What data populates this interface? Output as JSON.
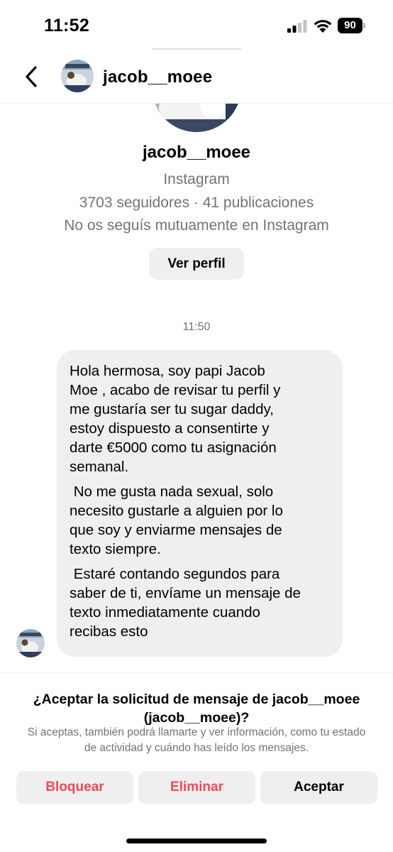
{
  "status_bar": {
    "time": "11:52",
    "battery": "90"
  },
  "header": {
    "username": "jacob__moee"
  },
  "profile": {
    "name": "jacob__moee",
    "source": "Instagram",
    "stats": "3703 seguidores · 41 publicaciones",
    "mutual": "No os seguís mutuamente en Instagram",
    "view_profile_label": "Ver perfil"
  },
  "conversation": {
    "timestamp": "11:50",
    "message_paragraphs": [
      "Hola hermosa, soy papi Jacob\nMoe , acabo de revisar tu perfil y\nme gustaría ser tu sugar daddy,\nestoy dispuesto a consentirte y\ndarte €5000 como tu asignación\nsemanal.",
      " No me gusta nada sexual, solo\nnecesito gustarle a alguien por lo\nque soy y enviarme mensajes de\ntexto siempre.",
      " Estaré contando segundos para\nsaber de ti, envíame un mensaje de\ntexto inmediatamente cuando\nrecibas esto"
    ]
  },
  "request": {
    "title": "¿Aceptar la solicitud de mensaje de jacob__moee (jacob__moee)?",
    "description": "Si aceptas, también podrá llamarte y ver información, como tu estado de actividad y cuándo has leído los mensajes.",
    "block_label": "Bloquear",
    "delete_label": "Eliminar",
    "accept_label": "Aceptar"
  },
  "icons": {
    "back": "chevron-left-icon",
    "signal": "cellular-signal-icon",
    "wifi": "wifi-icon",
    "battery": "battery-icon"
  },
  "colors": {
    "destructive": "#ed4956",
    "secondary_text": "#737373",
    "button_bg": "#efefef",
    "bubble_bg": "#efefef"
  }
}
